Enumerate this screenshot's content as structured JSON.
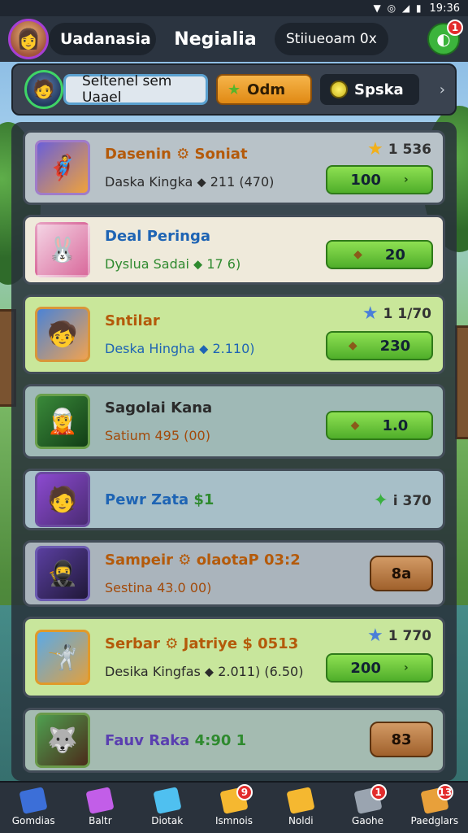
{
  "status_bar": {
    "time": "19:36",
    "icons": "▼ ◎ ◢ ▮"
  },
  "header": {
    "player_name": "Uadanasia",
    "title": "Negialia",
    "search_text": "Stiiueoam",
    "search_close": "0x",
    "notif_count": "1"
  },
  "filters": {
    "select_label": "Seltenel sem Uaael",
    "tab_orange": "Odm",
    "tab_dark": "Spska"
  },
  "rows": [
    {
      "name": "Dasenin",
      "name_extra": "Soniat",
      "sub": "Daska Kingka",
      "sub_val": "211 (470)",
      "price": "1 536",
      "button": "100"
    },
    {
      "name": "Deal Peringa",
      "name_extra": "",
      "sub": "Dyslua Sadai",
      "sub_val": "17 6)",
      "price": "",
      "button": "20"
    },
    {
      "name": "Sntilar",
      "name_extra": "",
      "sub": "Deska Hingha",
      "sub_val": "2.110)",
      "price": "1 1/70",
      "button": "230"
    },
    {
      "name": "Sagolai Kana",
      "name_extra": "",
      "sub": "Satium",
      "sub_val": "495 (00)",
      "price": "",
      "button": "1.0"
    },
    {
      "name": "Pewr Zata",
      "name_extra": "$1",
      "sub": "",
      "sub_val": "",
      "price": "i 370",
      "button": ""
    },
    {
      "name": "Sampeir",
      "name_extra": "olaotaP 03:2",
      "sub": "Sestina",
      "sub_val": "43.0 00)",
      "price": "",
      "button": "8a"
    },
    {
      "name": "Serbar",
      "name_extra": "Jatriye $ 0513",
      "sub": "Desika Kingfas",
      "sub_val": "2.011) (6.50)",
      "price": "1 770",
      "button": "200"
    },
    {
      "name": "Fauv Raka",
      "name_extra": "4:90 1",
      "sub": "",
      "sub_val": "",
      "price": "",
      "button": "83"
    }
  ],
  "nav": [
    {
      "label": "Gomdias",
      "color": "#3c6fd8",
      "badge": ""
    },
    {
      "label": "Baltr",
      "color": "#c25ee8",
      "badge": ""
    },
    {
      "label": "Diotak",
      "color": "#4fc0f0",
      "badge": ""
    },
    {
      "label": "Ismnois",
      "color": "#f5b830",
      "badge": "9"
    },
    {
      "label": "Noldi",
      "color": "#f5b830",
      "badge": ""
    },
    {
      "label": "Gaohe",
      "color": "#9aa4b0",
      "badge": "1"
    },
    {
      "label": "Paedglars",
      "color": "#e8a03a",
      "badge": "13"
    }
  ]
}
